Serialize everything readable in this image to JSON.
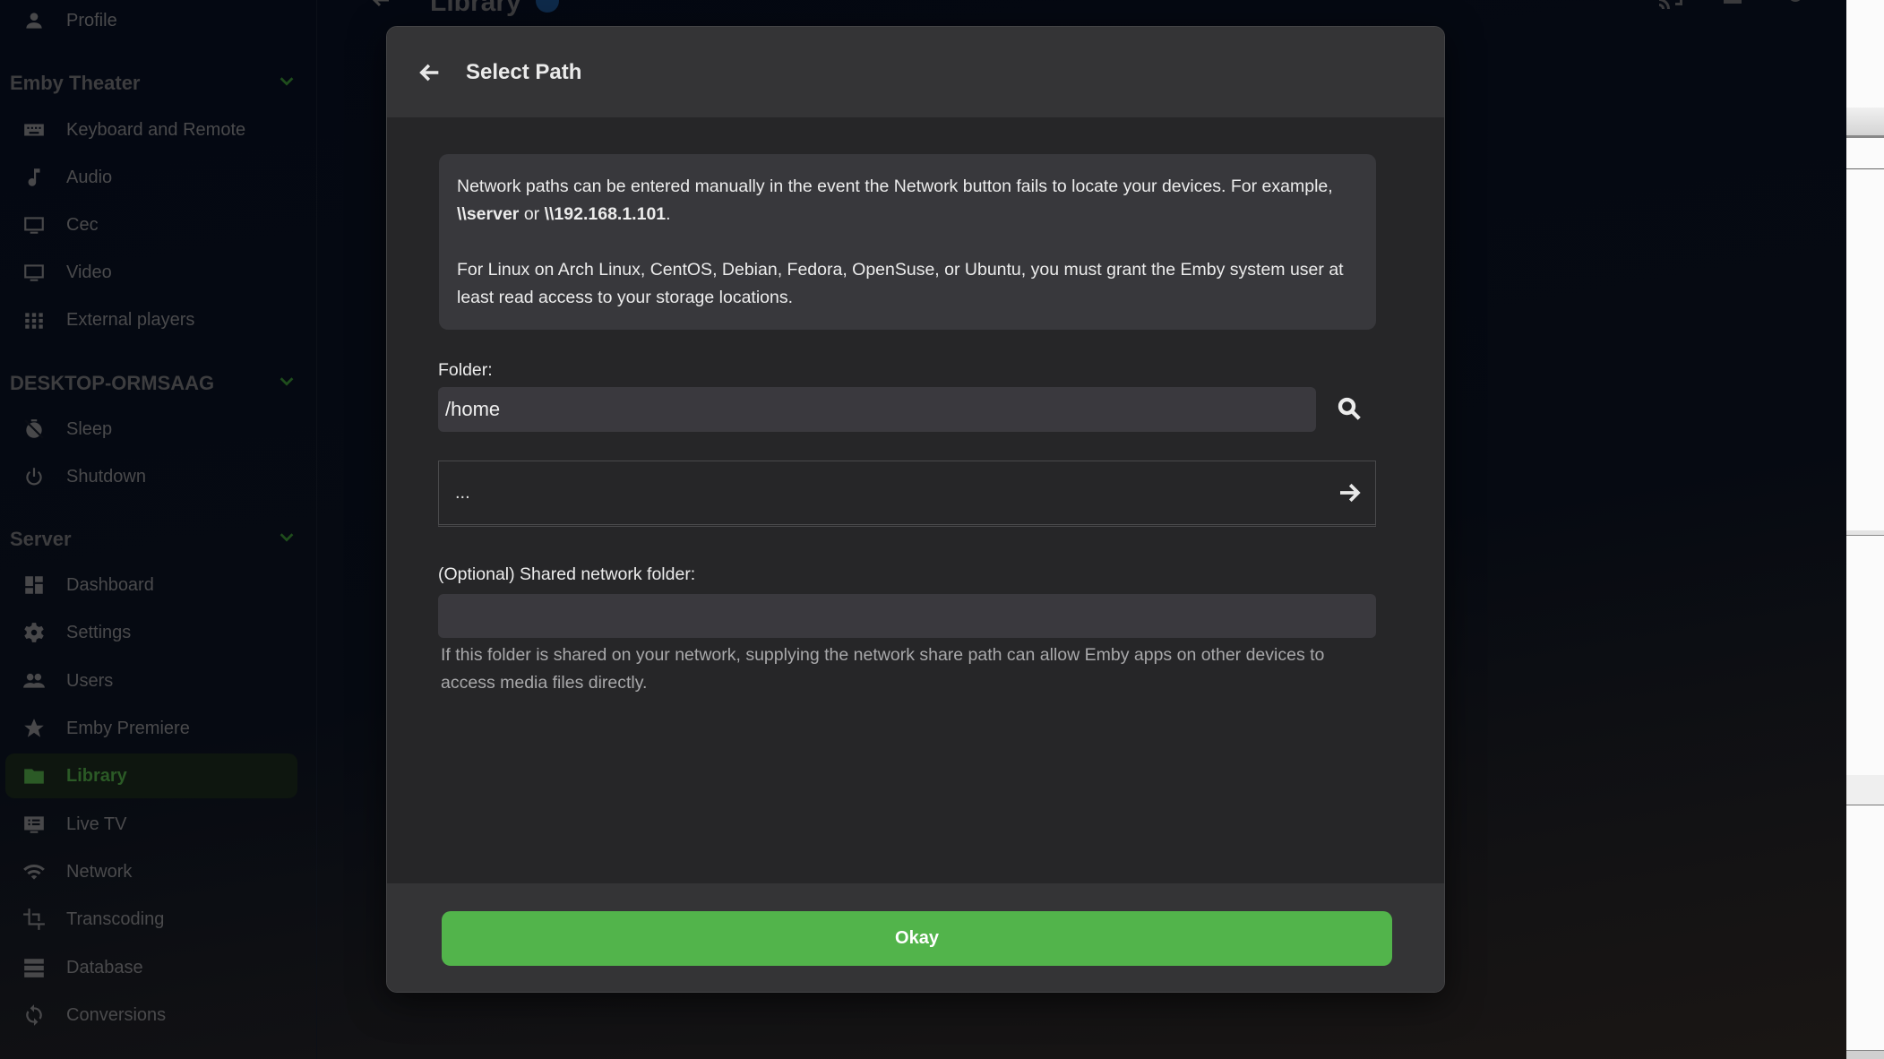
{
  "background_page": {
    "title": "Library",
    "header_icons": [
      "cast-icon",
      "user-icon",
      "settings-icon"
    ]
  },
  "sidebar": {
    "top_items": [
      {
        "label": "Profile",
        "icon": "person-icon"
      }
    ],
    "sections": [
      {
        "title": "Emby Theater",
        "items": [
          {
            "label": "Keyboard and Remote",
            "icon": "keyboard-icon"
          },
          {
            "label": "Audio",
            "icon": "music-note-icon"
          },
          {
            "label": "Cec",
            "icon": "monitor-icon"
          },
          {
            "label": "Video",
            "icon": "monitor-icon"
          },
          {
            "label": "External players",
            "icon": "grid-icon"
          }
        ]
      },
      {
        "title": "DESKTOP-ORMSAAG",
        "items": [
          {
            "label": "Sleep",
            "icon": "timer-off-icon"
          },
          {
            "label": "Shutdown",
            "icon": "power-icon"
          }
        ]
      },
      {
        "title": "Server",
        "items": [
          {
            "label": "Dashboard",
            "icon": "dashboard-icon"
          },
          {
            "label": "Settings",
            "icon": "gear-icon"
          },
          {
            "label": "Users",
            "icon": "people-icon"
          },
          {
            "label": "Emby Premiere",
            "icon": "star-icon"
          },
          {
            "label": "Library",
            "icon": "folder-icon",
            "active": true
          },
          {
            "label": "Live TV",
            "icon": "live-tv-icon"
          },
          {
            "label": "Network",
            "icon": "wifi-icon"
          },
          {
            "label": "Transcoding",
            "icon": "crop-icon"
          },
          {
            "label": "Database",
            "icon": "database-icon"
          },
          {
            "label": "Conversions",
            "icon": "sync-icon"
          }
        ]
      }
    ]
  },
  "dialog": {
    "title": "Select Path",
    "info": {
      "p1_prefix": "Network paths can be entered manually in the event the Network button fails to locate your devices. For example, ",
      "p1_example1": "\\\\server",
      "p1_or": " or ",
      "p1_example2": "\\\\192.168.1.101",
      "p1_suffix": ".",
      "p2": "For Linux on Arch Linux, CentOS, Debian, Fedora, OpenSuse, or Ubuntu, you must grant the Emby system user at least read access to your storage locations."
    },
    "folder_label": "Folder:",
    "folder_value": "/home",
    "directory_entries": [
      {
        "name": "..."
      }
    ],
    "share_label": "(Optional) Shared network folder:",
    "share_value": "",
    "share_help": "If this folder is shared on your network, supplying the network share path can allow Emby apps on other devices to access media files directly.",
    "okay_label": "Okay"
  },
  "colors": {
    "accent": "#52b44b",
    "dialog_bg": "#262628",
    "dialog_header_bg": "#343436",
    "input_bg": "#3a393e"
  }
}
